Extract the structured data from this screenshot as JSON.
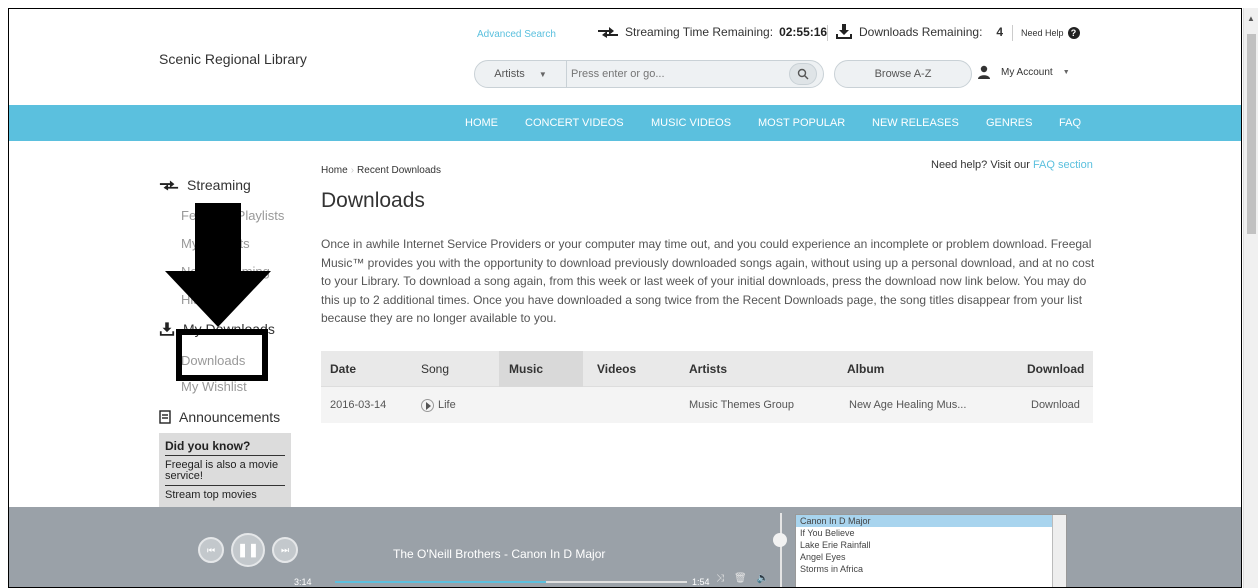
{
  "header": {
    "library_name": "Scenic Regional Library",
    "advanced_search": "Advanced Search",
    "streaming_label": "Streaming Time Remaining:",
    "streaming_time": "02:55:16",
    "downloads_label": "Downloads Remaining:",
    "downloads_count": "4",
    "need_help": "Need Help",
    "search_type": "Artists",
    "search_placeholder": "Press enter or go...",
    "browse_label": "Browse A-Z",
    "account_label": "My Account"
  },
  "nav": {
    "items": [
      {
        "label": "HOME"
      },
      {
        "label": "CONCERT VIDEOS"
      },
      {
        "label": "MUSIC VIDEOS"
      },
      {
        "label": "MOST POPULAR"
      },
      {
        "label": "NEW RELEASES"
      },
      {
        "label": "GENRES"
      },
      {
        "label": "FAQ"
      }
    ]
  },
  "sidebar": {
    "streaming": "Streaming",
    "featured_playlists": "Featured Playlists",
    "my_playlists": "My Playlists",
    "now_streaming": "Now Streaming",
    "history": "History",
    "my_downloads": "My Downloads",
    "downloads": "Downloads",
    "my_wishlist": "My Wishlist",
    "announcements": "Announcements",
    "did_you_know": "Did you know?",
    "dyk_items": [
      "Freegal is also a movie service!",
      "Stream top movies"
    ]
  },
  "main": {
    "crumbs": {
      "home": "Home",
      "current": "Recent Downloads"
    },
    "help_text": "Need help? Visit our",
    "help_link": "FAQ section",
    "title": "Downloads",
    "intro": "Once in awhile Internet Service Providers or your computer may time out, and you could experience an incomplete or problem download. Freegal Music™ provides you with the opportunity to download previously downloaded songs again, without using up a personal download, and at no cost to your Library. To download a song again, from this week or last week of your initial downloads, press the download now link below. You may do this up to 2 additional times. Once you have downloaded a song twice from the Recent Downloads page, the song titles disappear from your list because they are no longer available to you.",
    "columns": [
      "Date",
      "Song",
      "Music",
      "Videos",
      "Artists",
      "Album",
      "Download"
    ],
    "rows": [
      {
        "date": "2016-03-14",
        "song": "Life",
        "artist": "Music Themes Group",
        "album": "New Age Healing Mus...",
        "download": "Download"
      }
    ]
  },
  "player": {
    "now_playing": "The O'Neill Brothers - Canon In D Major",
    "elapsed": "3:14",
    "duration": "1:54",
    "progress": 0.6,
    "queue": [
      "Canon In D Major",
      "If You Believe",
      "Lake Erie Rainfall",
      "Angel Eyes",
      "Storms in Africa"
    ]
  }
}
